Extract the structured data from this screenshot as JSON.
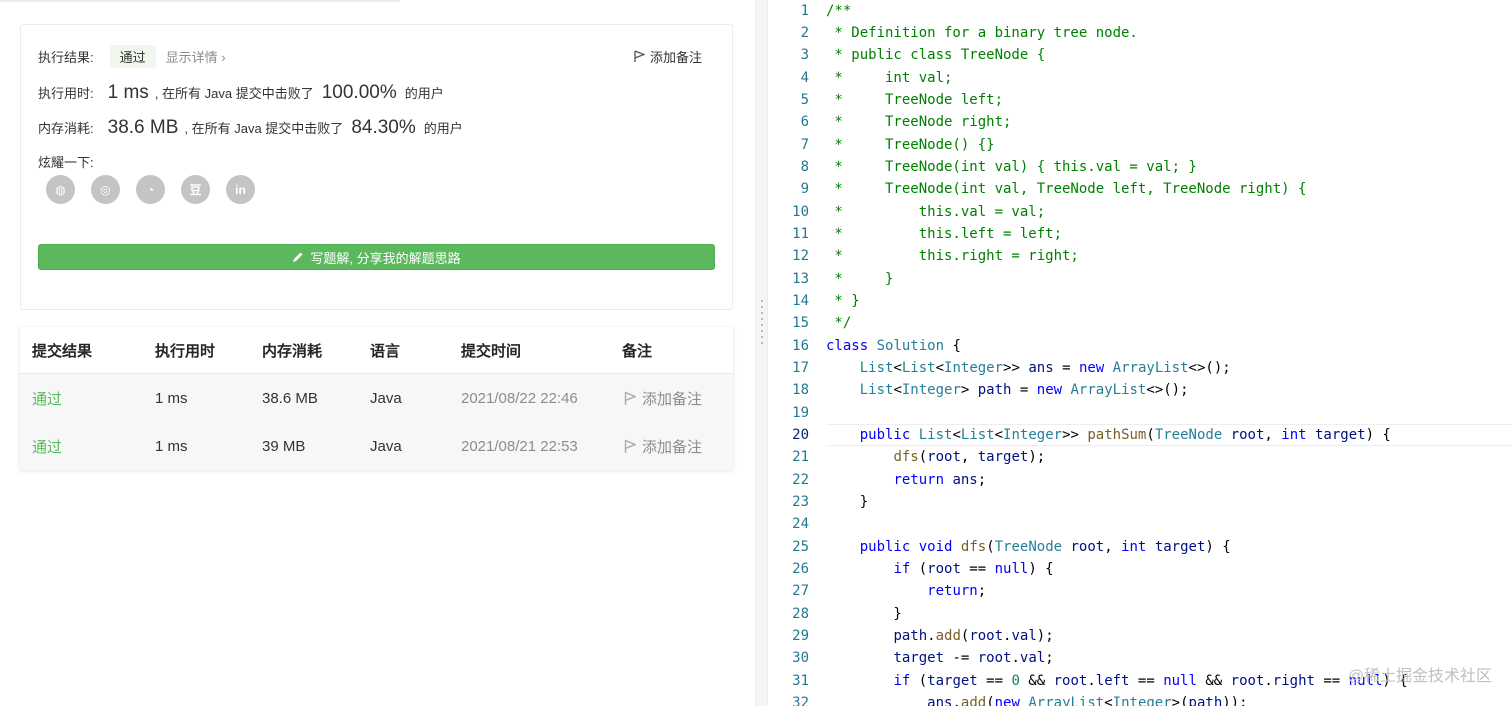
{
  "result": {
    "label": "执行结果:",
    "status": "通过",
    "details": "显示详情 ›",
    "add_note": "添加备注",
    "time_label": "执行用时:",
    "time_value": "1 ms",
    "time_text": ", 在所有 Java 提交中击败了",
    "time_pct": "100.00%",
    "time_suffix": "的用户",
    "mem_label": "内存消耗:",
    "mem_value": "38.6 MB",
    "mem_text": ", 在所有 Java 提交中击败了",
    "mem_pct": "84.30%",
    "mem_suffix": "的用户",
    "share_label": "炫耀一下:",
    "write_btn": "写题解, 分享我的解题思路"
  },
  "social": [
    "wechat-icon",
    "weibo-icon",
    "qq-icon",
    "douban-icon",
    "linkedin-icon"
  ],
  "social_glyphs": [
    "◍",
    "◎",
    "◔",
    "豆",
    "in"
  ],
  "table": {
    "headers": [
      "提交结果",
      "执行用时",
      "内存消耗",
      "语言",
      "提交时间",
      "备注"
    ],
    "rows": [
      {
        "status": "通过",
        "time": "1 ms",
        "memory": "38.6 MB",
        "lang": "Java",
        "date": "2021/08/22 22:46",
        "note": "添加备注"
      },
      {
        "status": "通过",
        "time": "1 ms",
        "memory": "39 MB",
        "lang": "Java",
        "date": "2021/08/21 22:53",
        "note": "添加备注"
      }
    ]
  },
  "watermark": "@稀土掘金技术社区",
  "colors": {
    "pass": "#5cb85c",
    "button": "#5cb85c"
  }
}
